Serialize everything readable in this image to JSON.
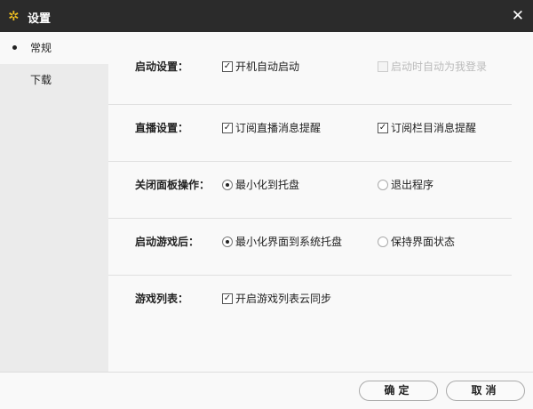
{
  "window": {
    "title": "设置",
    "icon": "gear-icon",
    "close_icon": "close-icon"
  },
  "sidebar": {
    "items": [
      {
        "label": "常规",
        "active": true
      },
      {
        "label": "下载",
        "active": false
      }
    ]
  },
  "sections": [
    {
      "label": "启动设置：",
      "options": [
        {
          "label": "开机自动启动",
          "type": "checkbox",
          "checked": true
        },
        {
          "label": "启动时自动为我登录",
          "type": "checkbox",
          "checked": false,
          "disabled": true
        }
      ]
    },
    {
      "label": "直播设置：",
      "options": [
        {
          "label": "订阅直播消息提醒",
          "type": "checkbox",
          "checked": true
        },
        {
          "label": "订阅栏目消息提醒",
          "type": "checkbox",
          "checked": true
        }
      ]
    },
    {
      "label": "关闭面板操作：",
      "options": [
        {
          "label": "最小化到托盘",
          "type": "radio",
          "checked": true
        },
        {
          "label": "退出程序",
          "type": "radio",
          "checked": false
        }
      ]
    },
    {
      "label": "启动游戏后：",
      "options": [
        {
          "label": "最小化界面到系统托盘",
          "type": "radio",
          "checked": true
        },
        {
          "label": "保持界面状态",
          "type": "radio",
          "checked": false
        }
      ]
    },
    {
      "label": "游戏列表：",
      "options": [
        {
          "label": "开启游戏列表云同步",
          "type": "checkbox",
          "checked": true
        }
      ]
    }
  ],
  "footer": {
    "ok": "确定",
    "cancel": "取消"
  }
}
